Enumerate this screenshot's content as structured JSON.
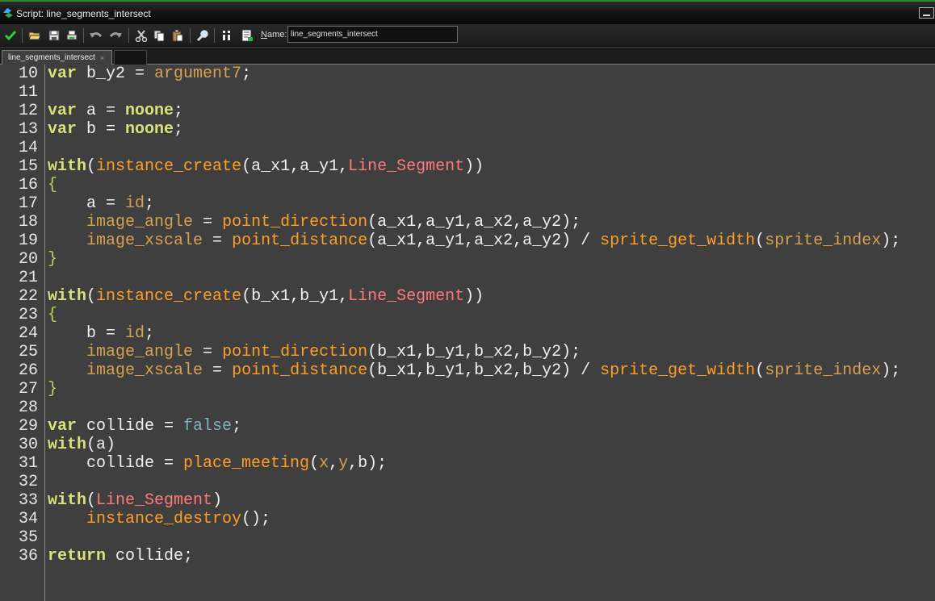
{
  "window": {
    "title": "Script: line_segments_intersect"
  },
  "toolbar": {
    "name_label": "Name:",
    "name_value": "line_segments_intersect",
    "buttons": [
      {
        "icon": "checkmark-icon",
        "name": "ok-button"
      },
      {
        "icon": "open-folder-icon",
        "name": "load-button"
      },
      {
        "icon": "save-icon",
        "name": "save-button"
      },
      {
        "icon": "print-icon",
        "name": "print-button"
      },
      {
        "icon": "undo-icon",
        "name": "undo-button"
      },
      {
        "icon": "redo-icon",
        "name": "redo-button"
      },
      {
        "icon": "cut-icon",
        "name": "cut-button"
      },
      {
        "icon": "copy-icon",
        "name": "copy-button"
      },
      {
        "icon": "paste-icon",
        "name": "paste-button"
      },
      {
        "icon": "search-icon",
        "name": "find-button"
      },
      {
        "icon": "goto-line-icon",
        "name": "goto-line-button"
      },
      {
        "icon": "script-icon",
        "name": "script-button"
      }
    ]
  },
  "tabs": [
    {
      "label": "line_segments_intersect",
      "close": "×"
    }
  ],
  "colors": {
    "keyword": "#d9e27a",
    "function": "#ff9e27",
    "builtin_var": "#d6a150",
    "object": "#ff7a7a",
    "constant": "#7fb2bb",
    "text": "#f0f0f0",
    "background": "#3f3f3f"
  },
  "code": [
    {
      "n": "10",
      "tokens": [
        [
          "kw",
          "var"
        ],
        [
          "txt",
          " b_y2 = "
        ],
        [
          "builtin",
          "argument7"
        ],
        [
          "txt",
          ";"
        ]
      ]
    },
    {
      "n": "11",
      "tokens": []
    },
    {
      "n": "12",
      "tokens": [
        [
          "kw",
          "var"
        ],
        [
          "txt",
          " a = "
        ],
        [
          "kw",
          "noone"
        ],
        [
          "txt",
          ";"
        ]
      ]
    },
    {
      "n": "13",
      "tokens": [
        [
          "kw",
          "var"
        ],
        [
          "txt",
          " b = "
        ],
        [
          "kw",
          "noone"
        ],
        [
          "txt",
          ";"
        ]
      ]
    },
    {
      "n": "14",
      "tokens": []
    },
    {
      "n": "15",
      "tokens": [
        [
          "kw",
          "with"
        ],
        [
          "txt",
          "("
        ],
        [
          "fn",
          "instance_create"
        ],
        [
          "txt",
          "(a_x1,a_y1,"
        ],
        [
          "obj",
          "Line_Segment"
        ],
        [
          "txt",
          "))"
        ]
      ]
    },
    {
      "n": "16",
      "tokens": [
        [
          "brace",
          "{"
        ]
      ]
    },
    {
      "n": "17",
      "tokens": [
        [
          "txt",
          "    a = "
        ],
        [
          "builtin",
          "id"
        ],
        [
          "txt",
          ";"
        ]
      ]
    },
    {
      "n": "18",
      "tokens": [
        [
          "txt",
          "    "
        ],
        [
          "builtin",
          "image_angle"
        ],
        [
          "txt",
          " = "
        ],
        [
          "fn",
          "point_direction"
        ],
        [
          "txt",
          "(a_x1,a_y1,a_x2,a_y2);"
        ]
      ]
    },
    {
      "n": "19",
      "tokens": [
        [
          "txt",
          "    "
        ],
        [
          "builtin",
          "image_xscale"
        ],
        [
          "txt",
          " = "
        ],
        [
          "fn",
          "point_distance"
        ],
        [
          "txt",
          "(a_x1,a_y1,a_x2,a_y2) / "
        ],
        [
          "fn",
          "sprite_get_width"
        ],
        [
          "txt",
          "("
        ],
        [
          "builtin",
          "sprite_index"
        ],
        [
          "txt",
          ");"
        ]
      ]
    },
    {
      "n": "20",
      "tokens": [
        [
          "brace",
          "}"
        ]
      ]
    },
    {
      "n": "21",
      "tokens": []
    },
    {
      "n": "22",
      "tokens": [
        [
          "kw",
          "with"
        ],
        [
          "txt",
          "("
        ],
        [
          "fn",
          "instance_create"
        ],
        [
          "txt",
          "(b_x1,b_y1,"
        ],
        [
          "obj",
          "Line_Segment"
        ],
        [
          "txt",
          "))"
        ]
      ]
    },
    {
      "n": "23",
      "tokens": [
        [
          "brace",
          "{"
        ]
      ]
    },
    {
      "n": "24",
      "tokens": [
        [
          "txt",
          "    b = "
        ],
        [
          "builtin",
          "id"
        ],
        [
          "txt",
          ";"
        ]
      ]
    },
    {
      "n": "25",
      "tokens": [
        [
          "txt",
          "    "
        ],
        [
          "builtin",
          "image_angle"
        ],
        [
          "txt",
          " = "
        ],
        [
          "fn",
          "point_direction"
        ],
        [
          "txt",
          "(b_x1,b_y1,b_x2,b_y2);"
        ]
      ]
    },
    {
      "n": "26",
      "tokens": [
        [
          "txt",
          "    "
        ],
        [
          "builtin",
          "image_xscale"
        ],
        [
          "txt",
          " = "
        ],
        [
          "fn",
          "point_distance"
        ],
        [
          "txt",
          "(b_x1,b_y1,b_x2,b_y2) / "
        ],
        [
          "fn",
          "sprite_get_width"
        ],
        [
          "txt",
          "("
        ],
        [
          "builtin",
          "sprite_index"
        ],
        [
          "txt",
          ");"
        ]
      ]
    },
    {
      "n": "27",
      "tokens": [
        [
          "brace",
          "}"
        ]
      ]
    },
    {
      "n": "28",
      "tokens": []
    },
    {
      "n": "29",
      "tokens": [
        [
          "kw",
          "var"
        ],
        [
          "txt",
          " collide = "
        ],
        [
          "const",
          "false"
        ],
        [
          "txt",
          ";"
        ]
      ]
    },
    {
      "n": "30",
      "tokens": [
        [
          "kw",
          "with"
        ],
        [
          "txt",
          "(a)"
        ]
      ]
    },
    {
      "n": "31",
      "tokens": [
        [
          "txt",
          "    collide = "
        ],
        [
          "fn",
          "place_meeting"
        ],
        [
          "txt",
          "("
        ],
        [
          "builtin",
          "x"
        ],
        [
          "txt",
          ","
        ],
        [
          "builtin",
          "y"
        ],
        [
          "txt",
          ",b);"
        ]
      ]
    },
    {
      "n": "32",
      "tokens": []
    },
    {
      "n": "33",
      "tokens": [
        [
          "kw",
          "with"
        ],
        [
          "txt",
          "("
        ],
        [
          "obj",
          "Line_Segment"
        ],
        [
          "txt",
          ")"
        ]
      ]
    },
    {
      "n": "34",
      "tokens": [
        [
          "txt",
          "    "
        ],
        [
          "fn",
          "instance_destroy"
        ],
        [
          "txt",
          "();"
        ]
      ]
    },
    {
      "n": "35",
      "tokens": []
    },
    {
      "n": "36",
      "tokens": [
        [
          "kw",
          "return"
        ],
        [
          "txt",
          " collide;"
        ]
      ]
    }
  ]
}
